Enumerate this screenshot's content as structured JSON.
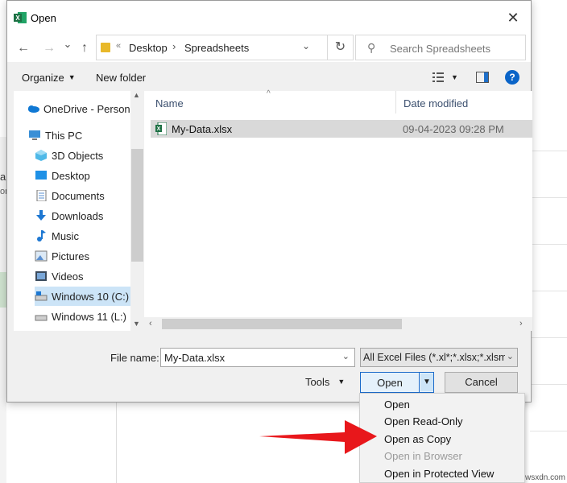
{
  "dialog": {
    "title": "Open",
    "close": "✕"
  },
  "navigation": {
    "back": "←",
    "forward": "→",
    "history": "⌄",
    "up": "↑",
    "address": {
      "separator": "«",
      "crumbs": [
        "Desktop",
        "Spreadsheets"
      ],
      "crumb_separator": "›",
      "dropdown": "⌄"
    },
    "refresh": "↻",
    "search_placeholder": "Search Spreadsheets"
  },
  "toolbar": {
    "organize": "Organize",
    "new_folder": "New folder",
    "help": "?"
  },
  "sidebar": {
    "items": [
      {
        "label": "OneDrive - Person",
        "icon": "cloud-icon"
      },
      {
        "label": "This PC",
        "icon": "computer-icon"
      },
      {
        "label": "3D Objects",
        "icon": "cube-icon"
      },
      {
        "label": "Desktop",
        "icon": "desktop-icon"
      },
      {
        "label": "Documents",
        "icon": "documents-icon"
      },
      {
        "label": "Downloads",
        "icon": "download-icon"
      },
      {
        "label": "Music",
        "icon": "music-icon"
      },
      {
        "label": "Pictures",
        "icon": "pictures-icon"
      },
      {
        "label": "Videos",
        "icon": "video-icon"
      },
      {
        "label": "Windows 10 (C:)",
        "icon": "drive-icon"
      },
      {
        "label": "Windows 11 (L:)",
        "icon": "drive-icon"
      }
    ],
    "selected": "Windows 10 (C:)"
  },
  "file_list": {
    "columns": [
      "Name",
      "Date modified"
    ],
    "files": [
      {
        "name": "My-Data.xlsx",
        "date_modified": "09-04-2023 09:28 PM",
        "icon": "excel-file-icon"
      }
    ]
  },
  "footer": {
    "file_name_label": "File name:",
    "file_name_value": "My-Data.xlsx",
    "file_type": "All Excel Files (*.xl*;*.xlsx;*.xlsm;*",
    "tools": "Tools",
    "open": "Open",
    "cancel": "Cancel"
  },
  "open_menu": {
    "items": [
      {
        "label": "Open",
        "enabled": true
      },
      {
        "label": "Open Read-Only",
        "enabled": true
      },
      {
        "label": "Open as Copy",
        "enabled": true
      },
      {
        "label": "Open in Browser",
        "enabled": false
      },
      {
        "label": "Open in Protected View",
        "enabled": true
      }
    ]
  },
  "background": {
    "fragment_1": "al",
    "fragment_2": "or"
  },
  "watermark": "wsxdn.com",
  "colors": {
    "accent": "#1b6ac9",
    "selection": "#cce4f7",
    "annotation_arrow": "#e8171b",
    "excel_green": "#1d7044"
  }
}
